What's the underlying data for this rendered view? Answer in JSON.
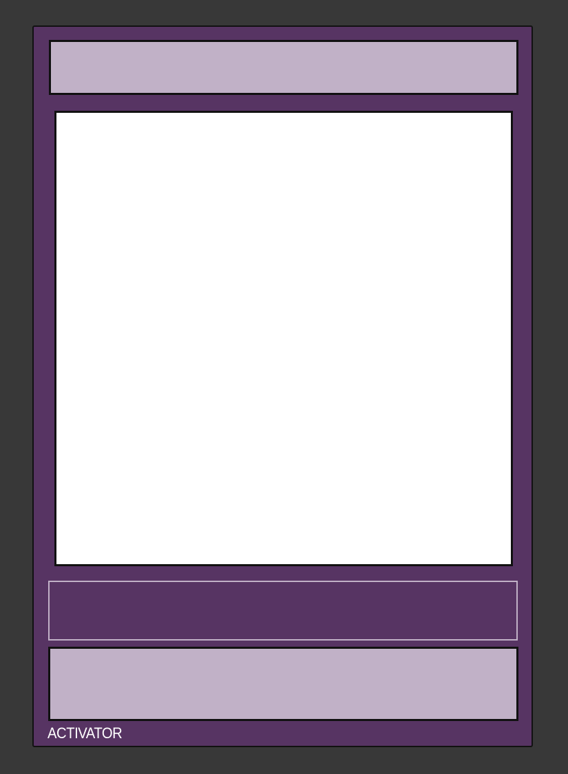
{
  "card": {
    "type_label": "ACTIVATOR",
    "colors": {
      "background": "#383838",
      "card_frame": "#573463",
      "panel_fill": "#c1b1c7",
      "art_fill": "#ffffff",
      "border": "#111111"
    }
  }
}
